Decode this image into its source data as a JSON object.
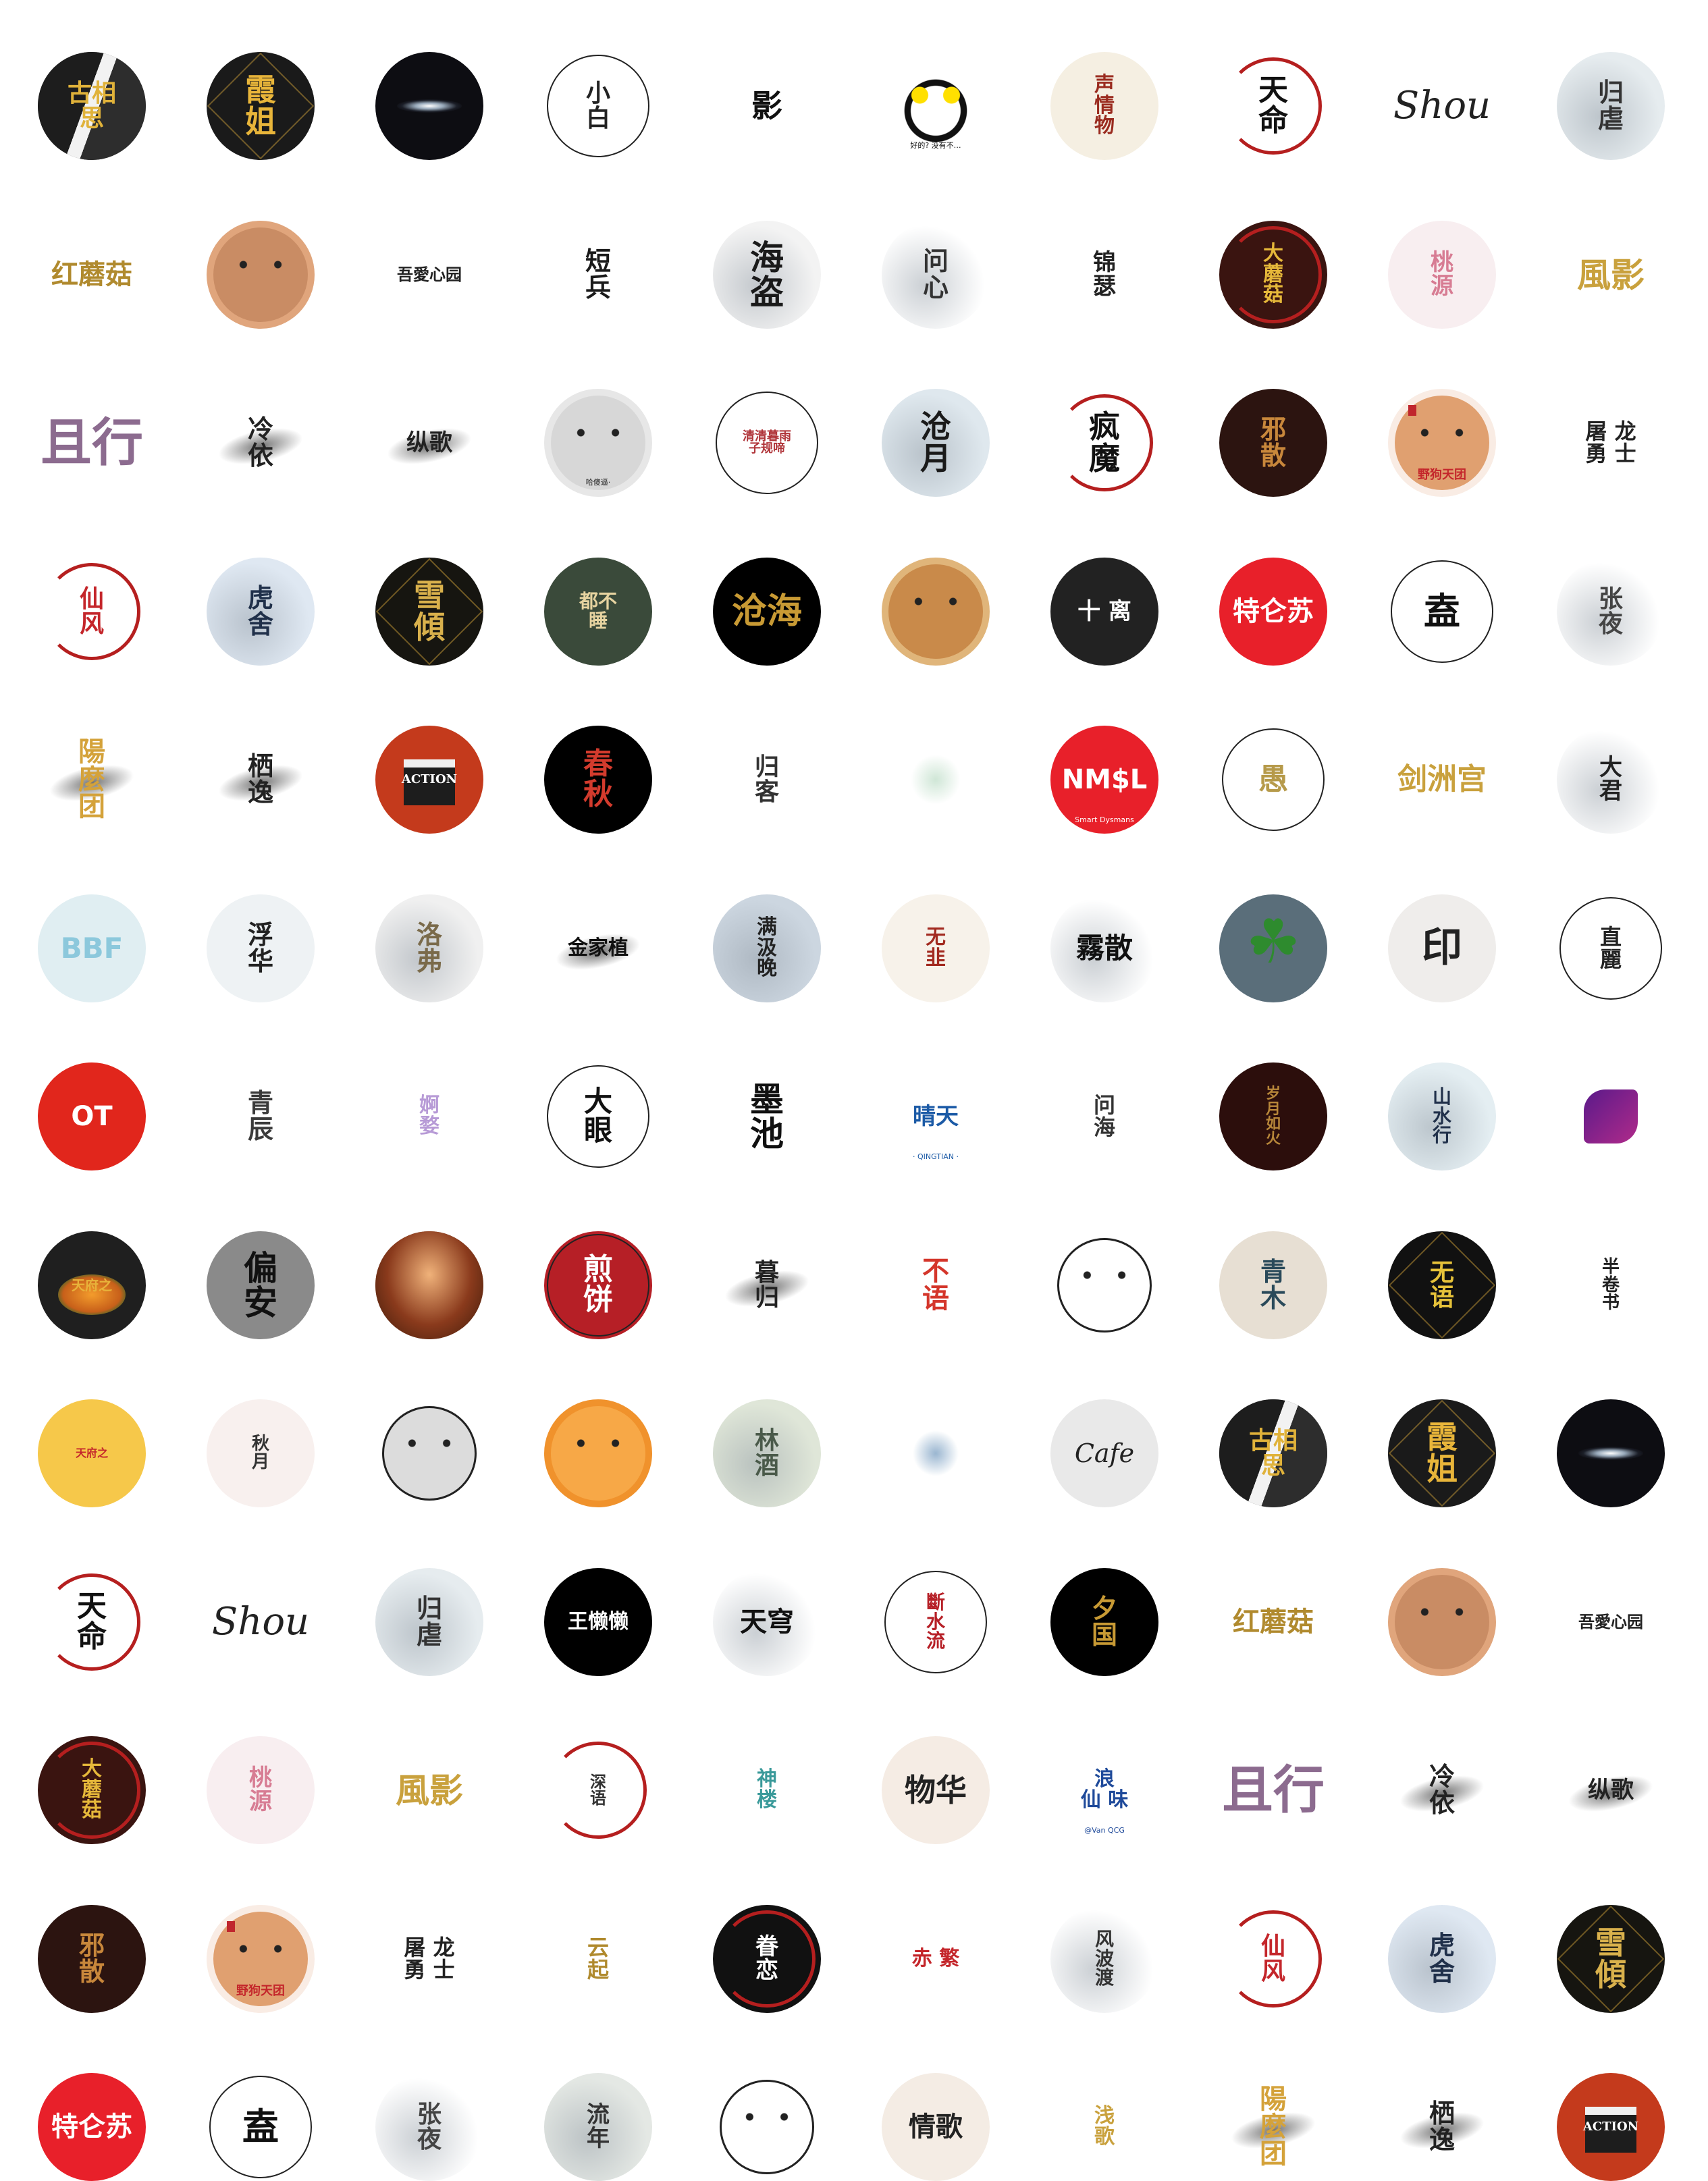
{
  "page": {
    "title": "",
    "columns": 10,
    "tile_count": 128
  },
  "avatars": [
    {
      "text": "古相\n思",
      "bg": "#2a2a2a",
      "fg": "#e0b23a",
      "fs": 36,
      "style": "split"
    },
    {
      "text": "霞\n姐",
      "bg": "#1a1a1a",
      "fg": "#e8b53a",
      "fs": 46,
      "style": "gold"
    },
    {
      "text": "",
      "bg": "#0d0d12",
      "fg": "#ffffff",
      "fs": 10,
      "style": "planet"
    },
    {
      "text": "小\n白",
      "bg": "#ffffff",
      "fg": "#222222",
      "fs": 36,
      "style": "thin-ring"
    },
    {
      "text": "影",
      "bg": "#ffffff",
      "fg": "#111111",
      "fs": 46,
      "style": "plain"
    },
    {
      "text": "",
      "bg": "#ffffff",
      "fg": "#111111",
      "fs": 10,
      "style": "panda",
      "sub": "好的? 没有不…"
    },
    {
      "text": "声\n情\n物",
      "bg": "#f5efe2",
      "fg": "#9a2b1f",
      "fs": 30,
      "style": "plain"
    },
    {
      "text": "天\n命",
      "bg": "#ffffff",
      "fg": "#111111",
      "fs": 44,
      "style": "ring"
    },
    {
      "text": "Shou",
      "bg": "#ffffff",
      "fg": "#222222",
      "fs": 56,
      "style": "script"
    },
    {
      "text": "归\n虐",
      "bg": "#e6ecef",
      "fg": "#333333",
      "fs": 38,
      "style": "wash"
    },
    {
      "text": "红蘑菇",
      "bg": "#ffffff",
      "fg": "#b08a2e",
      "fs": 40,
      "style": "plain"
    },
    {
      "text": "",
      "bg": "#e0a57c",
      "fg": "#3a2418",
      "fs": 10,
      "style": "face"
    },
    {
      "text": "吾愛心园",
      "bg": "#ffffff",
      "fg": "#222222",
      "fs": 24,
      "style": "plain"
    },
    {
      "text": "短\n兵",
      "bg": "#ffffff",
      "fg": "#1a1a1a",
      "fs": 38,
      "style": "plain"
    },
    {
      "text": "海\n盗",
      "bg": "#f3f3f3",
      "fg": "#1a1a1a",
      "fs": 50,
      "style": "wash"
    },
    {
      "text": "问\n心",
      "bg": "#ffffff",
      "fg": "#333333",
      "fs": 38,
      "style": "wash"
    },
    {
      "text": "锦\n瑟",
      "bg": "#ffffff",
      "fg": "#222222",
      "fs": 34,
      "style": "plain"
    },
    {
      "text": "大\n蘑\n菇",
      "bg": "#3a1410",
      "fg": "#e6b83a",
      "fs": 30,
      "style": "ring"
    },
    {
      "text": "桃\n源",
      "bg": "#f8eef0",
      "fg": "#d77c93",
      "fs": 34,
      "style": "plain"
    },
    {
      "text": "風影",
      "bg": "#ffffff",
      "fg": "#c9a13d",
      "fs": 50,
      "style": "plain"
    },
    {
      "text": "且行",
      "bg": "#ffffff",
      "fg": "#8c6b8f",
      "fs": 76,
      "style": "sans"
    },
    {
      "text": "冷\n依",
      "bg": "#ffffff",
      "fg": "#222222",
      "fs": 38,
      "style": "brush"
    },
    {
      "text": "纵歌",
      "bg": "#ffffff",
      "fg": "#222222",
      "fs": 34,
      "style": "brush"
    },
    {
      "text": "",
      "bg": "#e7e7e7",
      "fg": "#222222",
      "fs": 10,
      "style": "meme",
      "sub": "哈傻逼·"
    },
    {
      "text": "清清暮雨\n子规啼",
      "bg": "#ffffff",
      "fg": "#b0353a",
      "fs": 18,
      "style": "thin-ring"
    },
    {
      "text": "沧\n月",
      "bg": "#dfe8ee",
      "fg": "#1a1a1a",
      "fs": 46,
      "style": "wash"
    },
    {
      "text": "疯\n魔",
      "bg": "#ffffff",
      "fg": "#111111",
      "fs": 46,
      "style": "ring"
    },
    {
      "text": "邪\n散",
      "bg": "#2c1410",
      "fg": "#c8873b",
      "fs": 38,
      "style": "plain"
    },
    {
      "text": "野狗天团",
      "bg": "#f9ece4",
      "fg": "#c4262b",
      "fs": 18,
      "style": "dog"
    },
    {
      "text": "屠 龙\n勇 士",
      "bg": "#ffffff",
      "fg": "#222222",
      "fs": 32,
      "style": "plain"
    },
    {
      "text": "仙\n风",
      "bg": "#ffffff",
      "fg": "#c4262b",
      "fs": 36,
      "style": "ring"
    },
    {
      "text": "虎\n舍",
      "bg": "#dfe8f2",
      "fg": "#20304a",
      "fs": 38,
      "style": "wash"
    },
    {
      "text": "雪\n傾",
      "bg": "#161510",
      "fg": "#d9b14c",
      "fs": 46,
      "style": "gold"
    },
    {
      "text": "都不\n睡",
      "bg": "#3a4a3a",
      "fg": "#e6d3a0",
      "fs": 28,
      "style": "plain"
    },
    {
      "text": "沧海",
      "bg": "#000000",
      "fg": "#c89a34",
      "fs": 52,
      "style": "plain"
    },
    {
      "text": "",
      "bg": "#e0b57a",
      "fg": "#3a2418",
      "fs": 10,
      "style": "tiger"
    },
    {
      "text": "十 离",
      "bg": "#222222",
      "fg": "#ffffff",
      "fs": 34,
      "style": "plain"
    },
    {
      "text": "特仑苏",
      "bg": "#e8202a",
      "fg": "#ffffff",
      "fs": 40,
      "style": "plain"
    },
    {
      "text": "盍",
      "bg": "#ffffff",
      "fg": "#111111",
      "fs": 54,
      "style": "thin-ring"
    },
    {
      "text": "张\n夜",
      "bg": "#ffffff",
      "fg": "#444444",
      "fs": 36,
      "style": "wash"
    },
    {
      "text": "陽\n麼\n团",
      "bg": "#ffffff",
      "fg": "#d4a23a",
      "fs": 40,
      "style": "brush"
    },
    {
      "text": "栖\n逸",
      "bg": "#ffffff",
      "fg": "#222222",
      "fs": 38,
      "style": "brush"
    },
    {
      "text": "ACTION",
      "bg": "#c43a1c",
      "fg": "#ffffff",
      "fs": 18,
      "style": "clap"
    },
    {
      "text": "春\n秋",
      "bg": "#000000",
      "fg": "#d33b2d",
      "fs": 44,
      "style": "plain"
    },
    {
      "text": "归\n客",
      "bg": "#ffffff",
      "fg": "#333333",
      "fs": 36,
      "style": "plain"
    },
    {
      "text": "",
      "bg": "#ffffff",
      "fg": "#3a6a4a",
      "fs": 10,
      "style": "doodle"
    },
    {
      "text": "NM$L",
      "bg": "#e8202a",
      "fg": "#ffffff",
      "fs": 40,
      "style": "sans",
      "sub": "Smart Dysmans"
    },
    {
      "text": "愚",
      "bg": "#ffffff",
      "fg": "#b69a4a",
      "fs": 44,
      "style": "thin-ring"
    },
    {
      "text": "剑洲宫",
      "bg": "#ffffff",
      "fg": "#c9a13d",
      "fs": 44,
      "style": "plain"
    },
    {
      "text": "大\n君",
      "bg": "#ffffff",
      "fg": "#222222",
      "fs": 34,
      "style": "wash"
    },
    {
      "text": "BBF",
      "bg": "#e0eef2",
      "fg": "#8cc8dc",
      "fs": 42,
      "style": "sans"
    },
    {
      "text": "浮\n华",
      "bg": "#eef2f4",
      "fg": "#222222",
      "fs": 38,
      "style": "plain"
    },
    {
      "text": "洛\n弗",
      "bg": "#f0f0f0",
      "fg": "#7a6a4a",
      "fs": 38,
      "style": "wash"
    },
    {
      "text": "金家植",
      "bg": "#ffffff",
      "fg": "#111111",
      "fs": 30,
      "style": "brush"
    },
    {
      "text": "满\n汲\n晚",
      "bg": "#ccd6e0",
      "fg": "#222222",
      "fs": 30,
      "style": "wash"
    },
    {
      "text": "无\n韭",
      "bg": "#f7f2ea",
      "fg": "#a22a20",
      "fs": 30,
      "style": "plain"
    },
    {
      "text": "霧散",
      "bg": "#ffffff",
      "fg": "#111111",
      "fs": 42,
      "style": "wash"
    },
    {
      "text": "",
      "bg": "#5a6e7a",
      "fg": "#2e8b2e",
      "fs": 10,
      "style": "clover"
    },
    {
      "text": "印",
      "bg": "#efedeb",
      "fg": "#222222",
      "fs": 60,
      "style": "plain"
    },
    {
      "text": "直\n麗",
      "bg": "#ffffff",
      "fg": "#222222",
      "fs": 32,
      "style": "thin-ring"
    },
    {
      "text": "OT",
      "bg": "#e1261c",
      "fg": "#ffffff",
      "fs": 40,
      "style": "sans"
    },
    {
      "text": "青\n辰",
      "bg": "#ffffff",
      "fg": "#3a3a3a",
      "fs": 38,
      "style": "plain"
    },
    {
      "text": "婀\n婺",
      "bg": "#ffffff",
      "fg": "#b79ad6",
      "fs": 30,
      "style": "plain"
    },
    {
      "text": "大\n眼",
      "bg": "#ffffff",
      "fg": "#111111",
      "fs": 42,
      "style": "thin-ring"
    },
    {
      "text": "墨\n池",
      "bg": "#ffffff",
      "fg": "#111111",
      "fs": 50,
      "style": "plain"
    },
    {
      "text": "晴天",
      "bg": "#ffffff",
      "fg": "#1b5aa6",
      "fs": 34,
      "style": "sans",
      "sub": "· QINGTIAN ·"
    },
    {
      "text": "问\n海",
      "bg": "#ffffff",
      "fg": "#333333",
      "fs": 32,
      "style": "plain"
    },
    {
      "text": "岁\n月\n如\n火",
      "bg": "#2c0e0c",
      "fg": "#b8873a",
      "fs": 22,
      "style": "plain"
    },
    {
      "text": "山\n水\n行",
      "bg": "#e4eef2",
      "fg": "#20304a",
      "fs": 28,
      "style": "wash"
    },
    {
      "text": "",
      "bg": "#ffffff",
      "fg": "#4a1a7a",
      "fs": 10,
      "style": "leaf"
    },
    {
      "text": "天府之",
      "bg": "#1f1f1f",
      "fg": "#e8b23a",
      "fs": 20,
      "style": "food"
    },
    {
      "text": "偏\n安",
      "bg": "#8a8a8a",
      "fg": "#111111",
      "fs": 50,
      "style": "plain"
    },
    {
      "text": "",
      "bg": "#7a3a1e",
      "fg": "#e0a070",
      "fs": 10,
      "style": "blur"
    },
    {
      "text": "煎\n饼",
      "bg": "#b61f26",
      "fg": "#ffffff",
      "fs": 44,
      "style": "thin-ring"
    },
    {
      "text": "暮\n归",
      "bg": "#ffffff",
      "fg": "#222222",
      "fs": 36,
      "style": "brush"
    },
    {
      "text": "不\n语",
      "bg": "#ffffff",
      "fg": "#d4362b",
      "fs": 40,
      "style": "plain"
    },
    {
      "text": "",
      "bg": "#ffffff",
      "fg": "#111111",
      "fs": 10,
      "style": "pig-line"
    },
    {
      "text": "青\n木",
      "bg": "#e7dfd3",
      "fg": "#2a4a5a",
      "fs": 38,
      "style": "plain"
    },
    {
      "text": "无\n语",
      "bg": "#111111",
      "fg": "#e6c23a",
      "fs": 36,
      "style": "gold"
    },
    {
      "text": "半\n卷\n书",
      "bg": "#ffffff",
      "fg": "#222222",
      "fs": 26,
      "style": "plain"
    },
    {
      "text": "天府之",
      "bg": "#f6c84a",
      "fg": "#c4262b",
      "fs": 16,
      "style": "plain"
    },
    {
      "text": "秋\n月",
      "bg": "#f8f0ee",
      "fg": "#333333",
      "fs": 26,
      "style": "plain"
    },
    {
      "text": "",
      "bg": "#ffffff",
      "fg": "#444444",
      "fs": 10,
      "style": "cat"
    },
    {
      "text": "",
      "bg": "#f0922c",
      "fg": "#5a2a10",
      "fs": 10,
      "style": "pig"
    },
    {
      "text": "林\n酒",
      "bg": "#dfe6d8",
      "fg": "#4a5a4a",
      "fs": 36,
      "style": "wash"
    },
    {
      "text": "",
      "bg": "#ffffff",
      "fg": "#7a9abb",
      "fs": 10,
      "style": "splash"
    },
    {
      "text": "Cafe",
      "bg": "#e9e9e9",
      "fg": "#222222",
      "fs": 38,
      "style": "script"
    },
    {
      "text": "古相\n思",
      "bg": "#2a2a2a",
      "fg": "#e0b23a",
      "fs": 36,
      "style": "split"
    },
    {
      "text": "霞\n姐",
      "bg": "#1a1a1a",
      "fg": "#e8b53a",
      "fs": 46,
      "style": "gold"
    },
    {
      "text": "",
      "bg": "#0d0d12",
      "fg": "#ffffff",
      "fs": 10,
      "style": "planet"
    },
    {
      "text": "天\n命",
      "bg": "#ffffff",
      "fg": "#111111",
      "fs": 44,
      "style": "ring"
    },
    {
      "text": "Shou",
      "bg": "#ffffff",
      "fg": "#222222",
      "fs": 56,
      "style": "script"
    },
    {
      "text": "归\n虐",
      "bg": "#e6ecef",
      "fg": "#333333",
      "fs": 38,
      "style": "wash"
    },
    {
      "text": "王懒懒",
      "bg": "#000000",
      "fg": "#ffffff",
      "fs": 30,
      "style": "sans"
    },
    {
      "text": "天穹",
      "bg": "#ffffff",
      "fg": "#111111",
      "fs": 40,
      "style": "wash"
    },
    {
      "text": "斷\n水\n流",
      "bg": "#ffffff",
      "fg": "#b61f26",
      "fs": 28,
      "style": "thin-ring"
    },
    {
      "text": "夕\n国",
      "bg": "#000000",
      "fg": "#c89a34",
      "fs": 38,
      "style": "plain"
    },
    {
      "text": "红蘑菇",
      "bg": "#ffffff",
      "fg": "#b08a2e",
      "fs": 40,
      "style": "plain"
    },
    {
      "text": "",
      "bg": "#e0a57c",
      "fg": "#3a2418",
      "fs": 10,
      "style": "face"
    },
    {
      "text": "吾愛心园",
      "bg": "#ffffff",
      "fg": "#222222",
      "fs": 24,
      "style": "plain"
    },
    {
      "text": "大\n蘑\n菇",
      "bg": "#3a1410",
      "fg": "#e6b83a",
      "fs": 30,
      "style": "ring"
    },
    {
      "text": "桃\n源",
      "bg": "#f8eef0",
      "fg": "#d77c93",
      "fs": 34,
      "style": "plain"
    },
    {
      "text": "風影",
      "bg": "#ffffff",
      "fg": "#c9a13d",
      "fs": 50,
      "style": "plain"
    },
    {
      "text": "深\n语",
      "bg": "#ffffff",
      "fg": "#333333",
      "fs": 24,
      "style": "ring"
    },
    {
      "text": "神\n楼",
      "bg": "#ffffff",
      "fg": "#3a9a9a",
      "fs": 30,
      "style": "plain"
    },
    {
      "text": "物华",
      "bg": "#f5ece4",
      "fg": "#222222",
      "fs": 46,
      "style": "plain"
    },
    {
      "text": "浪\n仙 味",
      "bg": "#ffffff",
      "fg": "#1f4a9a",
      "fs": 30,
      "style": "plain",
      "sub": "@Van QCG"
    },
    {
      "text": "且行",
      "bg": "#ffffff",
      "fg": "#8c6b8f",
      "fs": 76,
      "style": "sans"
    },
    {
      "text": "冷\n依",
      "bg": "#ffffff",
      "fg": "#222222",
      "fs": 38,
      "style": "brush"
    },
    {
      "text": "纵歌",
      "bg": "#ffffff",
      "fg": "#222222",
      "fs": 34,
      "style": "brush"
    },
    {
      "text": "邪\n散",
      "bg": "#2c1410",
      "fg": "#c8873b",
      "fs": 38,
      "style": "plain"
    },
    {
      "text": "野狗天团",
      "bg": "#f9ece4",
      "fg": "#c4262b",
      "fs": 18,
      "style": "dog"
    },
    {
      "text": "屠 龙\n勇 士",
      "bg": "#ffffff",
      "fg": "#222222",
      "fs": 32,
      "style": "plain"
    },
    {
      "text": "云\n起",
      "bg": "#ffffff",
      "fg": "#b08a2e",
      "fs": 32,
      "style": "plain"
    },
    {
      "text": "眷\n恋",
      "bg": "#111111",
      "fg": "#ffffff",
      "fs": 34,
      "style": "ring"
    },
    {
      "text": "赤 繁",
      "bg": "#ffffff",
      "fg": "#c4262b",
      "fs": 30,
      "style": "plain"
    },
    {
      "text": "风\n波\n渡",
      "bg": "#ffffff",
      "fg": "#333333",
      "fs": 28,
      "style": "wash"
    },
    {
      "text": "仙\n风",
      "bg": "#ffffff",
      "fg": "#c4262b",
      "fs": 36,
      "style": "ring"
    },
    {
      "text": "虎\n舍",
      "bg": "#dfe8f2",
      "fg": "#20304a",
      "fs": 38,
      "style": "wash"
    },
    {
      "text": "雪\n傾",
      "bg": "#161510",
      "fg": "#d9b14c",
      "fs": 46,
      "style": "gold"
    },
    {
      "text": "特仑苏",
      "bg": "#e8202a",
      "fg": "#ffffff",
      "fs": 40,
      "style": "plain"
    },
    {
      "text": "盍",
      "bg": "#ffffff",
      "fg": "#111111",
      "fs": 54,
      "style": "thin-ring"
    },
    {
      "text": "张\n夜",
      "bg": "#ffffff",
      "fg": "#444444",
      "fs": 36,
      "style": "wash"
    },
    {
      "text": "流\n年",
      "bg": "#e4e8e4",
      "fg": "#333333",
      "fs": 34,
      "style": "wash"
    },
    {
      "text": "",
      "bg": "#ffffff",
      "fg": "#111111",
      "fs": 10,
      "style": "ghost"
    },
    {
      "text": "情歌",
      "bg": "#f4ece4",
      "fg": "#222222",
      "fs": 40,
      "style": "plain"
    },
    {
      "text": "浅\n歌",
      "bg": "#ffffff",
      "fg": "#c9a13d",
      "fs": 30,
      "style": "plain"
    },
    {
      "text": "陽\n麼\n团",
      "bg": "#ffffff",
      "fg": "#d4a23a",
      "fs": 40,
      "style": "brush"
    },
    {
      "text": "栖\n逸",
      "bg": "#ffffff",
      "fg": "#222222",
      "fs": 38,
      "style": "brush"
    },
    {
      "text": "ACTION",
      "bg": "#c43a1c",
      "fg": "#ffffff",
      "fs": 18,
      "style": "clap"
    }
  ]
}
